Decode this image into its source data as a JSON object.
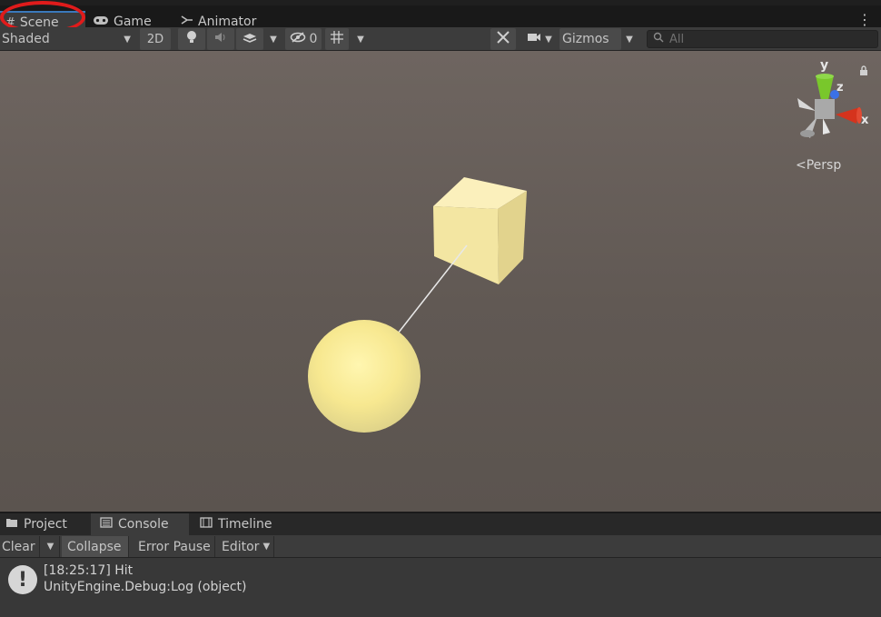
{
  "window_tabs": {
    "scene": "Scene",
    "game": "Game",
    "animator": "Animator"
  },
  "scene_toolbar": {
    "shading_mode": "Shaded",
    "mode_2d": "2D",
    "hidden_count": "0",
    "gizmos": "Gizmos",
    "search_placeholder": "All"
  },
  "scene_view": {
    "projection_label": "Persp",
    "axis_labels": {
      "x": "x",
      "y": "y",
      "z": "z"
    }
  },
  "bottom_tabs": {
    "project": "Project",
    "console": "Console",
    "timeline": "Timeline"
  },
  "console_toolbar": {
    "clear": "Clear",
    "collapse": "Collapse",
    "error_pause": "Error Pause",
    "editor": "Editor"
  },
  "console_log": {
    "line1": "[18:25:17] Hit",
    "line2": "UnityEngine.Debug:Log (object)"
  },
  "colors": {
    "axis_x": "#d5331d",
    "axis_y": "#79c72b",
    "axis_z": "#3b71e6",
    "highlight_circle": "#e01b1b",
    "object_yellow": "#f5e6a1"
  }
}
